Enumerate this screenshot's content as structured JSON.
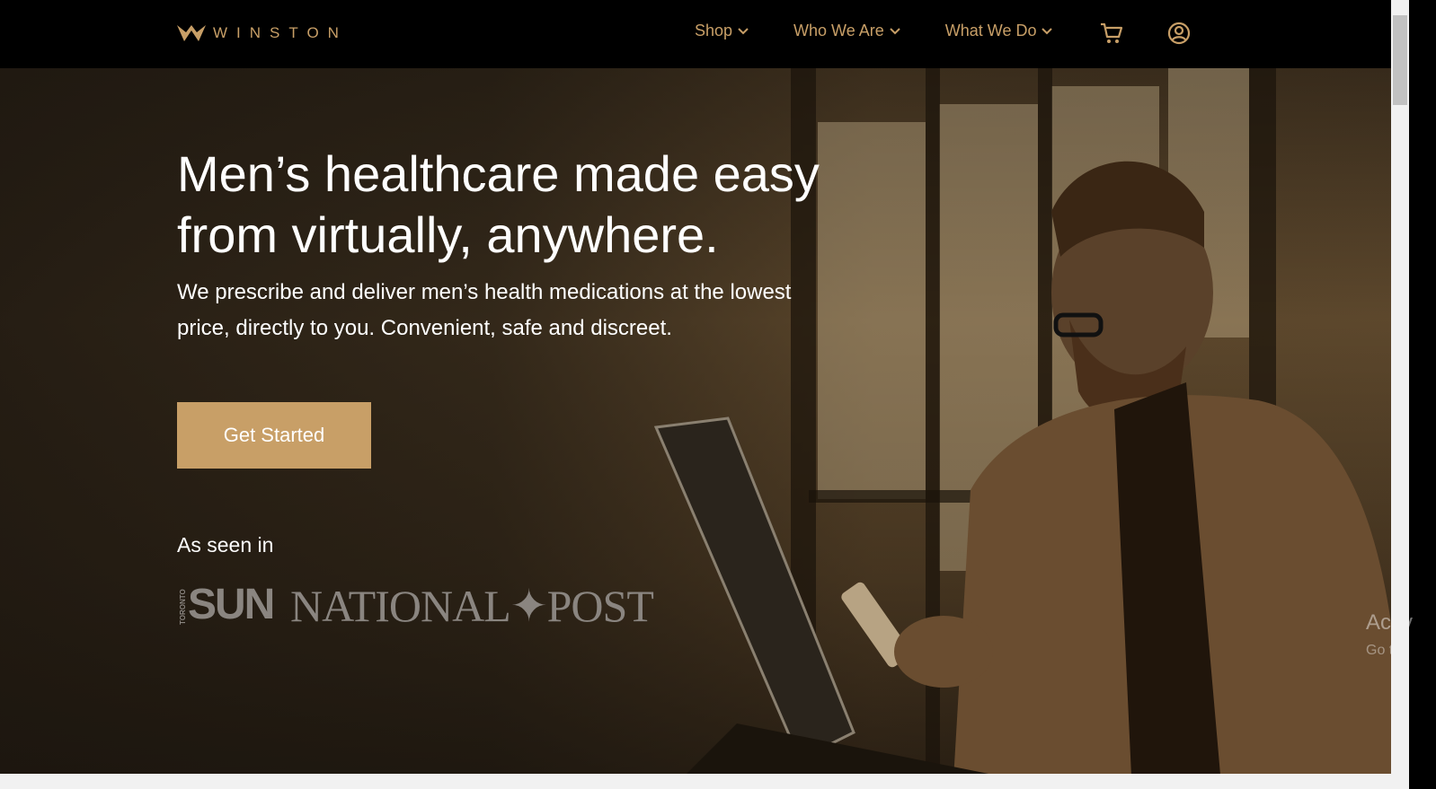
{
  "nav": {
    "brand": "WINSTON",
    "items": [
      {
        "label": "Shop"
      },
      {
        "label": "Who We Are"
      },
      {
        "label": "What We Do"
      }
    ],
    "cart_icon": "cart-icon",
    "account_icon": "account-icon"
  },
  "hero": {
    "title_line1": "Men’s healthcare made easy",
    "title_line2": "from virtually, anywhere.",
    "subtitle": "We prescribe and deliver men’s health medications at the lowest price, directly to you. Convenient, safe and discreet.",
    "cta_label": "Get Started",
    "seen_label": "As seen in",
    "press": {
      "sun_small": "TORONTO",
      "sun": "SUN",
      "national_post": "NATIONAL✦POST"
    }
  },
  "watermark": {
    "line1": "Activ",
    "line2": "Go to"
  },
  "colors": {
    "accent": "#c89f67",
    "nav_bg": "#000000"
  }
}
